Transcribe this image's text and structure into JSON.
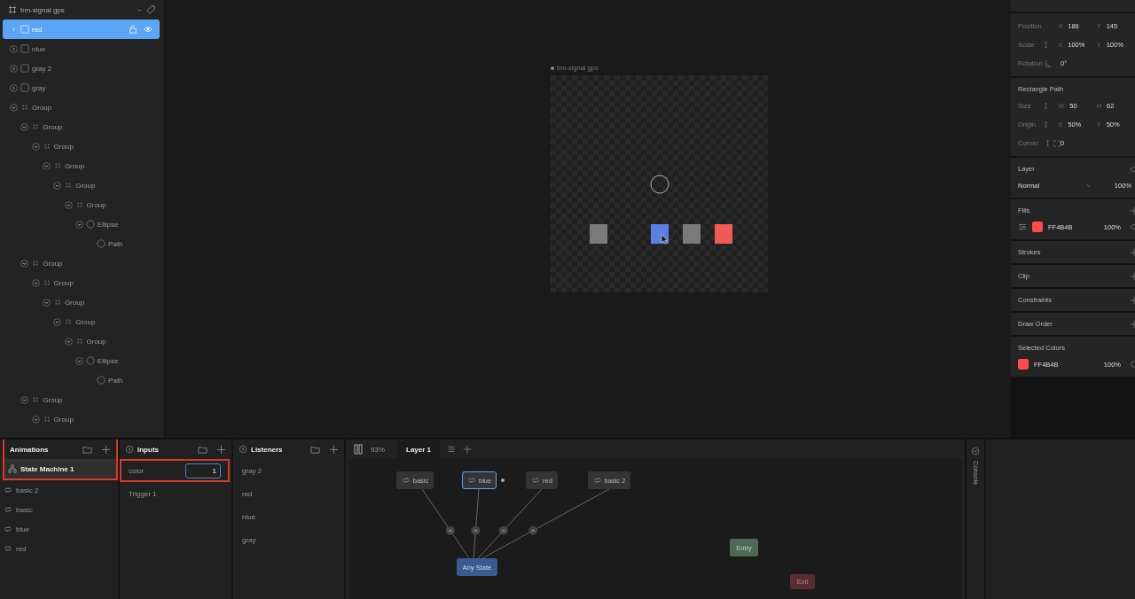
{
  "hierarchy": {
    "artboard": "bm-signal gps",
    "items": [
      {
        "name": "red",
        "kind": "rectangle",
        "selected": true,
        "expanded": false
      },
      {
        "name": "nlue",
        "kind": "rectangle",
        "selected": false,
        "expanded": false
      },
      {
        "name": "gray 2",
        "kind": "rectangle",
        "selected": false,
        "expanded": false
      },
      {
        "name": "gray",
        "kind": "rectangle",
        "selected": false,
        "expanded": false
      },
      {
        "name": "Group",
        "kind": "group",
        "selected": false,
        "expanded": true,
        "children": [
          {
            "name": "Group",
            "kind": "group",
            "selected": false,
            "expanded": true,
            "children": [
              {
                "name": "Group",
                "kind": "group",
                "selected": false,
                "expanded": true,
                "children": [
                  {
                    "name": "Group",
                    "kind": "group",
                    "selected": false,
                    "expanded": true,
                    "children": [
                      {
                        "name": "Group",
                        "kind": "group",
                        "selected": false,
                        "expanded": true,
                        "children": [
                          {
                            "name": "Group",
                            "kind": "group",
                            "selected": false,
                            "expanded": true,
                            "children": [
                              {
                                "name": "Ellipse",
                                "kind": "ellipse",
                                "selected": false,
                                "expanded": true,
                                "children": [
                                  {
                                    "name": "Path",
                                    "kind": "path",
                                    "selected": false
                                  }
                                ]
                              }
                            ]
                          }
                        ]
                      }
                    ]
                  }
                ]
              }
            ]
          },
          {
            "name": "Group",
            "kind": "group",
            "selected": false,
            "expanded": true,
            "children": [
              {
                "name": "Group",
                "kind": "group",
                "selected": false,
                "expanded": true,
                "children": [
                  {
                    "name": "Group",
                    "kind": "group",
                    "selected": false,
                    "expanded": true,
                    "children": [
                      {
                        "name": "Group",
                        "kind": "group",
                        "selected": false,
                        "expanded": true,
                        "children": [
                          {
                            "name": "Group",
                            "kind": "group",
                            "selected": false,
                            "expanded": true,
                            "children": [
                              {
                                "name": "Ellipse",
                                "kind": "ellipse",
                                "selected": false,
                                "expanded": true,
                                "children": [
                                  {
                                    "name": "Path",
                                    "kind": "path",
                                    "selected": false
                                  }
                                ]
                              }
                            ]
                          }
                        ]
                      }
                    ]
                  }
                ]
              }
            ]
          },
          {
            "name": "Group",
            "kind": "group",
            "selected": false,
            "expanded": true,
            "children": [
              {
                "name": "Group",
                "kind": "group",
                "selected": false,
                "expanded": true
              }
            ]
          }
        ]
      }
    ]
  },
  "canvas": {
    "artboard_label": "bm-signal gps",
    "shapes": [
      {
        "kind": "ellipse"
      },
      {
        "kind": "rectangle",
        "color": "#7a7a7a"
      },
      {
        "kind": "rectangle",
        "color": "#5b80e2"
      },
      {
        "kind": "rectangle",
        "color": "#7a7a7a"
      },
      {
        "kind": "rectangle",
        "color": "#ef5a55"
      }
    ]
  },
  "inspector": [
    {
      "kind": "properties",
      "rows": [
        {
          "label": "Position",
          "kind": "plain",
          "fields": [
            {
              "axis": "X",
              "value": "186"
            },
            {
              "axis": "Y",
              "value": "145"
            }
          ]
        },
        {
          "label": "Scale",
          "kind": "linked",
          "fields": [
            {
              "axis": "X",
              "value": "100%"
            },
            {
              "axis": "Y",
              "value": "100%"
            }
          ]
        },
        {
          "label": "Rotation",
          "kind": "angle",
          "fields": [
            {
              "value": "0°"
            }
          ]
        }
      ]
    },
    {
      "kind": "properties",
      "title": "Rectangle Path",
      "rows": [
        {
          "label": "Size",
          "kind": "linked",
          "fields": [
            {
              "axis": "W",
              "value": "50"
            },
            {
              "axis": "H",
              "value": "62"
            }
          ]
        },
        {
          "label": "Origin",
          "kind": "linked",
          "fields": [
            {
              "axis": "X",
              "value": "50%"
            },
            {
              "axis": "Y",
              "value": "50%"
            }
          ]
        },
        {
          "label": "Corner",
          "kind": "corner",
          "fields": [
            {
              "value": "0"
            }
          ]
        }
      ]
    },
    {
      "kind": "layer",
      "title": "Layer",
      "blend": "Normal",
      "opacity": "100%"
    },
    {
      "kind": "fills",
      "title": "Fills",
      "items": [
        {
          "hex": "FF4B4B",
          "color": "#ff4b4b",
          "opacity": "100%"
        }
      ]
    },
    {
      "kind": "empty",
      "title": "Strokes"
    },
    {
      "kind": "empty",
      "title": "Clip"
    },
    {
      "kind": "empty",
      "title": "Constraints"
    },
    {
      "kind": "empty",
      "title": "Draw Order"
    },
    {
      "kind": "colors",
      "title": "Selected Colors",
      "items": [
        {
          "hex": "FF4B4B",
          "color": "#ff4b4b",
          "opacity": "100%"
        }
      ]
    }
  ],
  "animations": {
    "title": "Animations",
    "highlighted": true,
    "items": [
      {
        "name": "State Machine 1",
        "kind": "state-machine",
        "selected": true
      },
      {
        "name": "basic 2",
        "kind": "animation",
        "selected": false
      },
      {
        "name": "basic",
        "kind": "animation",
        "selected": false
      },
      {
        "name": "blue",
        "kind": "animation",
        "selected": false
      },
      {
        "name": "red",
        "kind": "animation",
        "selected": false
      }
    ]
  },
  "inputs": {
    "title": "Inputs",
    "items": [
      {
        "name": "color",
        "kind": "number",
        "value": "1",
        "highlighted": true
      },
      {
        "name": "Trigger 1",
        "kind": "trigger",
        "highlighted": false
      }
    ]
  },
  "listeners": {
    "title": "Listeners",
    "items": [
      "gray 2",
      "red",
      "nlue",
      "gray"
    ]
  },
  "graph": {
    "zoom": "93%",
    "layers": [
      {
        "label": "Layer 1",
        "selected": true
      }
    ],
    "nodes": [
      {
        "label": "basic",
        "kind": "animation",
        "selected": false
      },
      {
        "label": "blue",
        "kind": "animation",
        "selected": true
      },
      {
        "label": "red",
        "kind": "animation",
        "selected": false
      },
      {
        "label": "basic 2",
        "kind": "animation",
        "selected": false
      },
      {
        "label": "Any State",
        "kind": "any",
        "selected": false
      },
      {
        "label": "Entry",
        "kind": "entry",
        "selected": false
      },
      {
        "label": "Exit",
        "kind": "exit",
        "selected": false
      }
    ]
  },
  "console": "Console"
}
